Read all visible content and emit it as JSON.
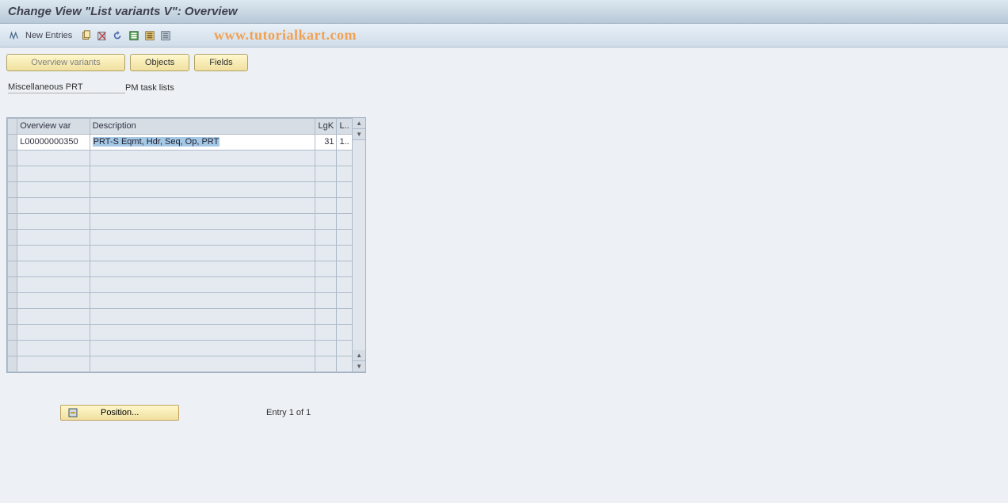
{
  "title": "Change View \"List variants                   V\": Overview",
  "toolbar": {
    "new_entries": "New Entries"
  },
  "watermark": "www.tutorialkart.com",
  "tabs": {
    "overview_variants": "Overview variants",
    "objects": "Objects",
    "fields": "Fields"
  },
  "fixed": {
    "label": "Miscellaneous PRT",
    "value": "PM task lists"
  },
  "table": {
    "headers": {
      "overview_var": "Overview var",
      "description": "Description",
      "lgk": "LgK",
      "l": "L.."
    },
    "rows": [
      {
        "overview_var": "L00000000350",
        "description": "PRT-S Eqmt, Hdr, Seq, Op, PRT",
        "lgk": "31",
        "l": "1.."
      }
    ]
  },
  "footer": {
    "position": "Position...",
    "entry_text": "Entry 1 of 1"
  }
}
